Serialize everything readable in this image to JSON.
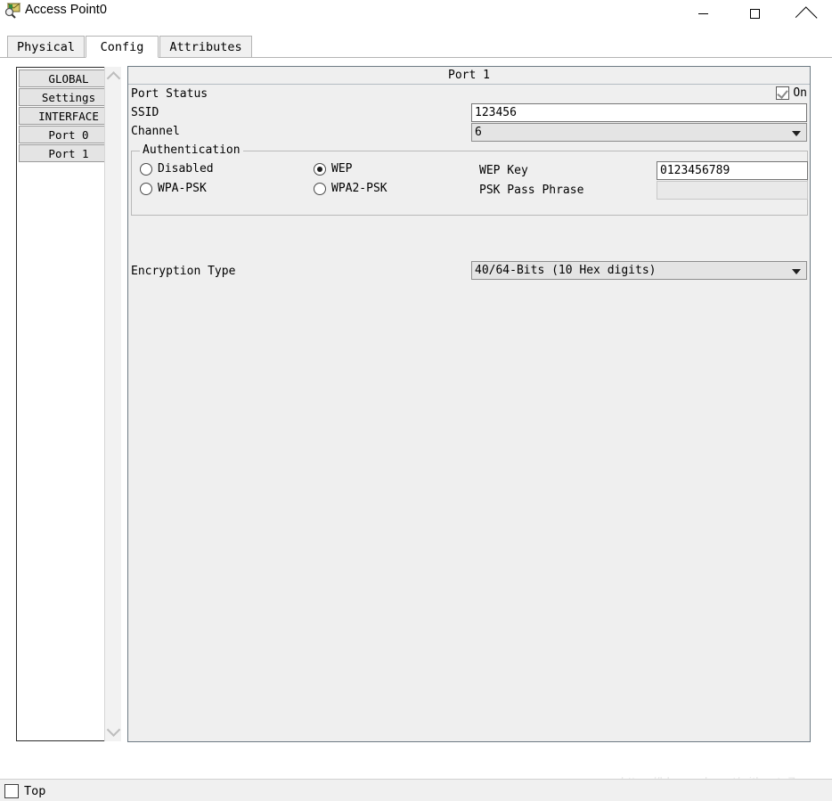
{
  "window": {
    "title": "Access Point0",
    "icon": "access-point-icon",
    "controls": {
      "minimize": "minimize-icon",
      "maximize": "maximize-icon",
      "close": "close-icon"
    }
  },
  "tabs": [
    {
      "label": "Physical",
      "selected": false
    },
    {
      "label": "Config",
      "selected": true
    },
    {
      "label": "Attributes",
      "selected": false
    }
  ],
  "sidebar": {
    "items": [
      {
        "label": "GLOBAL"
      },
      {
        "label": "Settings"
      },
      {
        "label": "INTERFACE"
      },
      {
        "label": "Port 0"
      },
      {
        "label": "Port 1"
      }
    ],
    "scroll": {
      "up": "chevron-up-icon",
      "down": "chevron-down-icon"
    }
  },
  "panel": {
    "title": "Port 1",
    "port_status": {
      "label": "Port Status",
      "checkbox_label": "On",
      "checked": true
    },
    "ssid": {
      "label": "SSID",
      "value": "123456",
      "placeholder": ""
    },
    "channel": {
      "label": "Channel",
      "value": "6"
    },
    "authentication": {
      "legend": "Authentication",
      "selected": "WEP",
      "options": [
        {
          "label": "Disabled",
          "selected": false
        },
        {
          "label": "WEP",
          "selected": true
        },
        {
          "label": "WPA-PSK",
          "selected": false
        },
        {
          "label": "WPA2-PSK",
          "selected": false
        }
      ],
      "wep_key": {
        "label": "WEP Key",
        "value": "0123456789",
        "disabled": false
      },
      "psk_pass_phrase": {
        "label": "PSK Pass Phrase",
        "value": "",
        "disabled": true
      }
    },
    "encryption_type": {
      "label": "Encryption Type",
      "value": "40/64-Bits (10 Hex digits)"
    }
  },
  "bottom": {
    "top_checkbox": {
      "label": "Top",
      "checked": false
    }
  },
  "watermark": "https://blog.csdn.net/without_Zzz",
  "colors": {
    "panel_bg": "#efefef",
    "panel_border": "#6e7b84",
    "combo_bg": "#e4e4e4",
    "disabled_bg": "#e9e9e9",
    "tab_bg": "#f0f0f0",
    "selected_tab_bg": "#ffffff",
    "nav_btn_bg": "#e4e4e4"
  }
}
